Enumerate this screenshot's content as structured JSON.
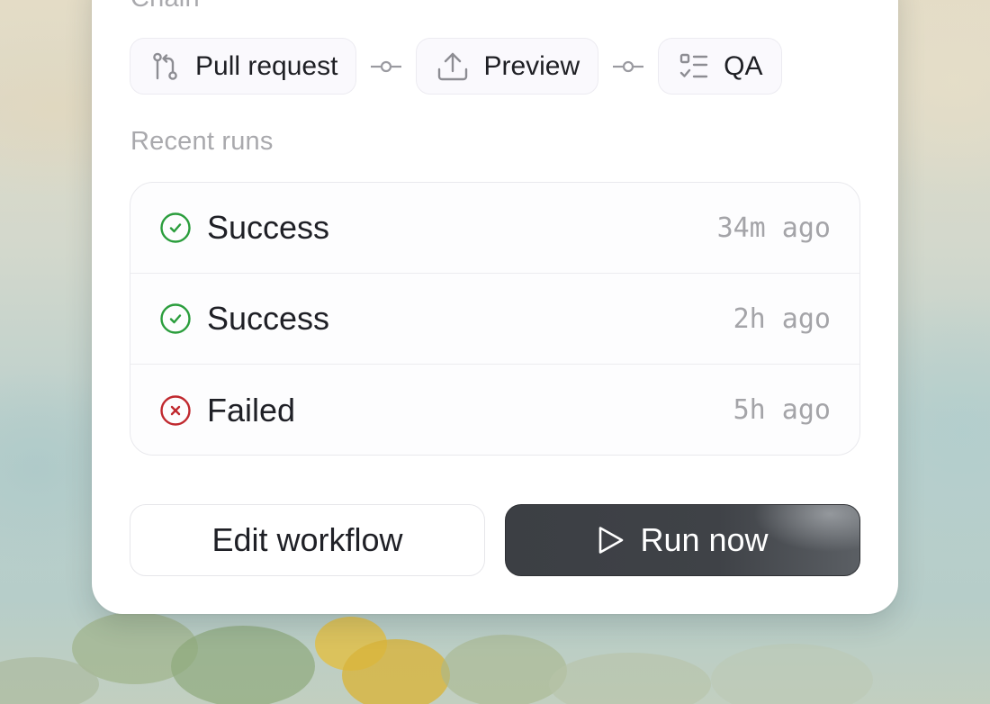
{
  "chain": {
    "label": "Chain",
    "steps": [
      {
        "label": "Pull request",
        "icon": "git-pull-request-icon"
      },
      {
        "label": "Preview",
        "icon": "upload-icon"
      },
      {
        "label": "QA",
        "icon": "checklist-icon"
      }
    ]
  },
  "runs": {
    "label": "Recent runs",
    "items": [
      {
        "status": "Success",
        "time": "34m ago",
        "icon": "check-circle-icon",
        "color": "#2a9d3c"
      },
      {
        "status": "Success",
        "time": "2h ago",
        "icon": "check-circle-icon",
        "color": "#2a9d3c"
      },
      {
        "status": "Failed",
        "time": "5h ago",
        "icon": "x-circle-icon",
        "color": "#c0282e"
      }
    ]
  },
  "actions": {
    "edit_label": "Edit workflow",
    "run_label": "Run now"
  },
  "colors": {
    "success": "#2a9d3c",
    "failure": "#c0282e",
    "primary_button": "#3c3f44"
  }
}
